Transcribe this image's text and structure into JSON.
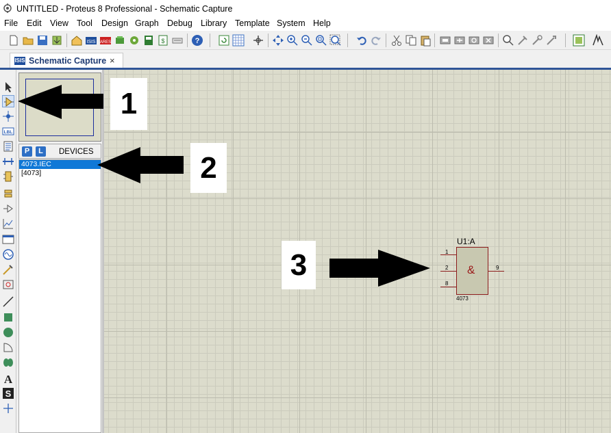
{
  "window": {
    "title": "UNTITLED - Proteus 8 Professional - Schematic Capture"
  },
  "menu": [
    "File",
    "Edit",
    "View",
    "Tool",
    "Design",
    "Graph",
    "Debug",
    "Library",
    "Template",
    "System",
    "Help"
  ],
  "tab": {
    "label": "Schematic Capture",
    "close": "×",
    "icon_text": "ISIS"
  },
  "devices_panel": {
    "p_button": "P",
    "l_button": "L",
    "title": "DEVICES",
    "items": [
      {
        "label": "4073.IEC",
        "selected": true
      },
      {
        "label": "[4073]",
        "selected": false
      }
    ]
  },
  "left_tools": {
    "text_tool_glyph": "A",
    "symbol_tool_glyph": "S",
    "label_tool_text": "LBL"
  },
  "component": {
    "reference": "U1:A",
    "part": "4073",
    "symbol": "&",
    "pins": {
      "in1": "1",
      "in2": "2",
      "in3": "8",
      "out": "9"
    }
  },
  "annotations": {
    "one": "1",
    "two": "2",
    "three": "3"
  },
  "colors": {
    "canvas": "#dcdccc",
    "grid_major": "#bcbcae",
    "grid_minor": "#cbcbbd",
    "selection": "#0f78d7",
    "component_border": "#8b1a1a",
    "component_fill": "#c8c8b0"
  }
}
